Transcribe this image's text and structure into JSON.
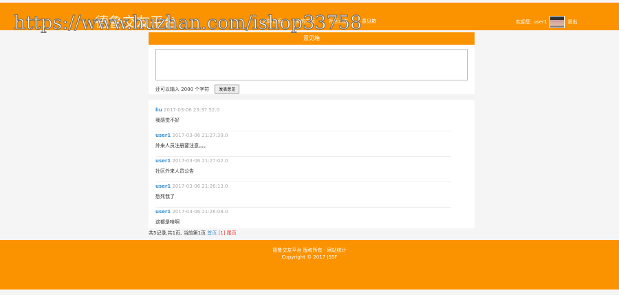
{
  "header": {
    "logo": "德鲁交友平台",
    "watermark": "https://www.huzhan.com/ishop33758",
    "nav": [
      "网站首页",
      "我的主页",
      "社区动态",
      "意见箱"
    ],
    "welcome": "欢迎您: user1",
    "logout": "退出"
  },
  "main": {
    "title": "意见箱",
    "textarea_value": "",
    "remaining": "还可以输入 2000 个字符",
    "submit": "发表意见",
    "items": [
      {
        "name": "liu",
        "time": "2017-03-06 23:37:52.0",
        "content": "我感觉不好"
      },
      {
        "name": "user1",
        "time": "2017-03-06 21:27:39.0",
        "content": "外来人员注册要注意。。。"
      },
      {
        "name": "user1",
        "time": "2017-03-06 21:27:02.0",
        "content": "社区外来人员公告"
      },
      {
        "name": "user1",
        "time": "2017-03-06 21:26:13.0",
        "content": "愁死我了"
      },
      {
        "name": "user1",
        "time": "2017-03-06 21:26:08.0",
        "content": "这都是啥啊"
      }
    ]
  },
  "pager": {
    "summary": "共5记录,共1页, 当前第1页",
    "first": "首页",
    "current": "[1]",
    "last": "尾页"
  },
  "footer": {
    "line1": "德鲁交友平台 版权所有 - 网站统计",
    "line2": "Copyright © 2017 JSSF"
  }
}
